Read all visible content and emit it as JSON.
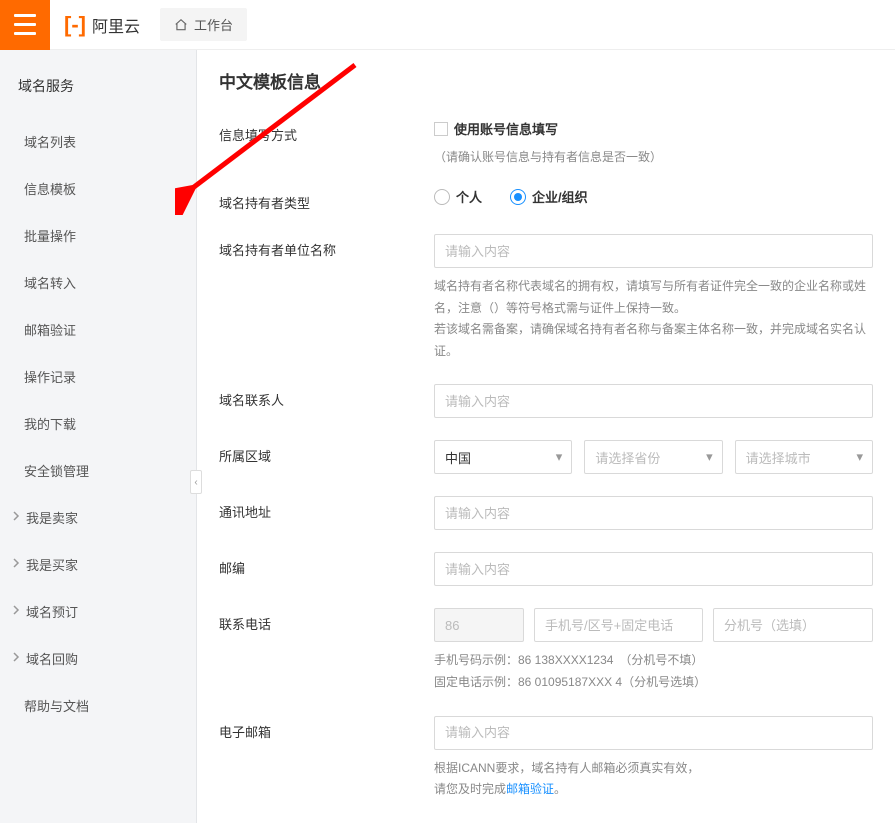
{
  "header": {
    "brand": "阿里云",
    "workbench": "工作台"
  },
  "sidebar": {
    "title": "域名服务",
    "items": [
      {
        "label": "域名列表",
        "chevron": false
      },
      {
        "label": "信息模板",
        "chevron": false
      },
      {
        "label": "批量操作",
        "chevron": false
      },
      {
        "label": "域名转入",
        "chevron": false
      },
      {
        "label": "邮箱验证",
        "chevron": false
      },
      {
        "label": "操作记录",
        "chevron": false
      },
      {
        "label": "我的下载",
        "chevron": false
      },
      {
        "label": "安全锁管理",
        "chevron": false
      },
      {
        "label": "我是卖家",
        "chevron": true
      },
      {
        "label": "我是买家",
        "chevron": true
      },
      {
        "label": "域名预订",
        "chevron": true
      },
      {
        "label": "域名回购",
        "chevron": true
      },
      {
        "label": "帮助与文档",
        "chevron": false
      }
    ]
  },
  "page": {
    "title": "中文模板信息"
  },
  "form": {
    "fill_method": {
      "label": "信息填写方式",
      "checkbox_label": "使用账号信息填写",
      "hint": "（请确认账号信息与持有者信息是否一致）"
    },
    "holder_type": {
      "label": "域名持有者类型",
      "options": {
        "personal": "个人",
        "org": "企业/组织"
      },
      "selected": "org"
    },
    "org_name": {
      "label": "域名持有者单位名称",
      "placeholder": "请输入内容",
      "help": "域名持有者名称代表域名的拥有权，请填写与所有者证件完全一致的企业名称或姓名，注意（）等符号格式需与证件上保持一致。\n若该域名需备案，请确保域名持有者名称与备案主体名称一致，并完成域名实名认证。"
    },
    "contact": {
      "label": "域名联系人",
      "placeholder": "请输入内容"
    },
    "region": {
      "label": "所属区域",
      "country": "中国",
      "province_placeholder": "请选择省份",
      "city_placeholder": "请选择城市"
    },
    "address": {
      "label": "通讯地址",
      "placeholder": "请输入内容"
    },
    "postcode": {
      "label": "邮编",
      "placeholder": "请输入内容"
    },
    "phone": {
      "label": "联系电话",
      "cc": "86",
      "main_placeholder": "手机号/区号+固定电话",
      "ext_placeholder": "分机号（选填）",
      "help_line1": "手机号码示例：86 138XXXX1234　（分机号不填）",
      "help_line2": "固定电话示例：86 01095187XXX 4（分机号选填）"
    },
    "email": {
      "label": "电子邮箱",
      "placeholder": "请输入内容",
      "help_prefix": "根据ICANN要求，域名持有人邮箱必须真实有效，",
      "help_prefix2": "请您及时完成",
      "link_text": "邮箱验证",
      "help_suffix": "。"
    }
  }
}
